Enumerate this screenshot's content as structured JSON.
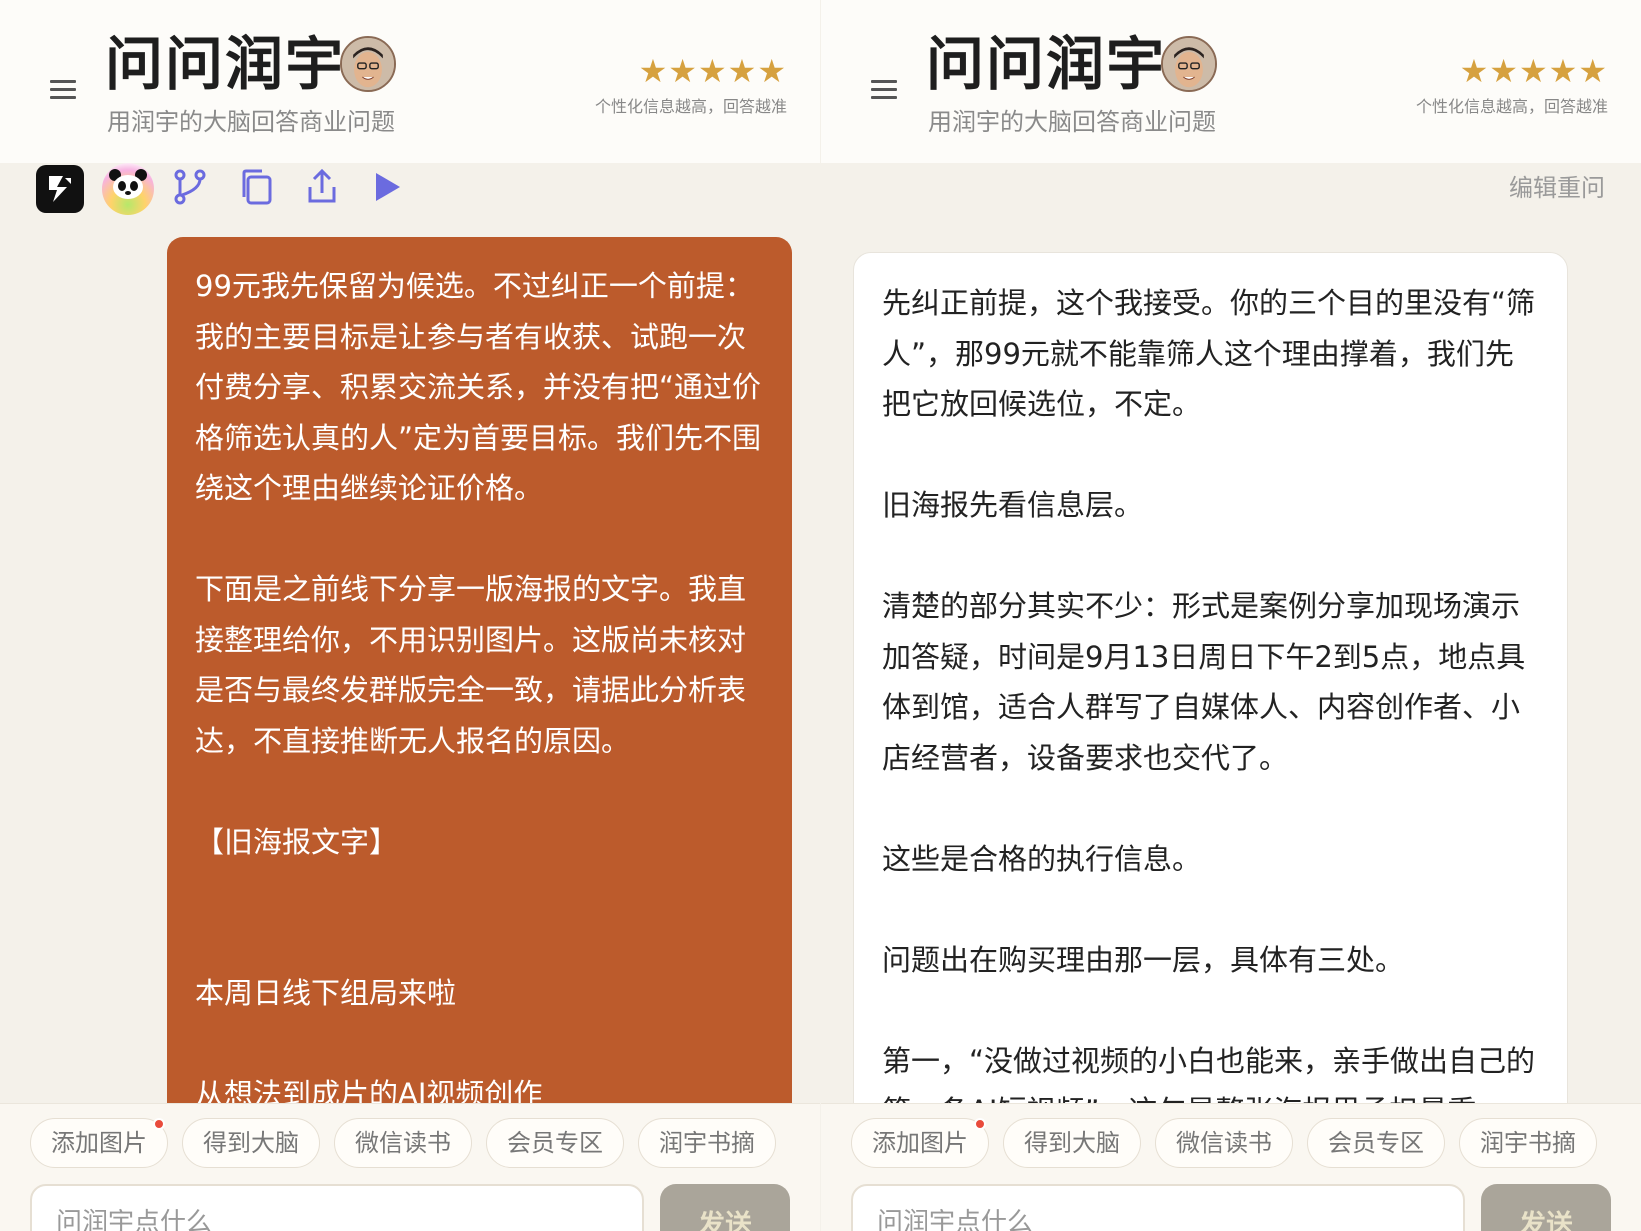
{
  "left": {
    "header": {
      "title": "问问润宇",
      "subtitle": "用润宇的大脑回答商业问题",
      "stars": "★★★★★",
      "rating_note": "个性化信息越高，回答越准"
    },
    "message": {
      "paragraphs": [
        "99元我先保留为候选。不过纠正一个前提：我的主要目标是让参与者有收获、试跑一次付费分享、积累交流关系，并没有把“通过价格筛选认真的人”定为首要目标。我们先不围绕这个理由继续论证价格。",
        "下面是之前线下分享一版海报的文字。我直接整理给你，不用识别图片。这版尚未核对是否与最终发群版完全一致，请据此分析表达，不直接推断无人报名的原因。",
        "【旧海报文字】",
        "本周日线下组局来啦",
        "从想法到成片的AI视频创作"
      ]
    },
    "chips": [
      "添加图片",
      "得到大脑",
      "微信读书",
      "会员专区",
      "润宇书摘"
    ],
    "input": {
      "placeholder": "问润宇点什么"
    },
    "send_label": "发送"
  },
  "right": {
    "header": {
      "title": "问问润宇",
      "subtitle": "用润宇的大脑回答商业问题",
      "stars": "★★★★★",
      "rating_note": "个性化信息越高，回答越准"
    },
    "edit_link": "编辑重问",
    "message": {
      "paragraphs": [
        "先纠正前提，这个我接受。你的三个目的里没有“筛人”，那99元就不能靠筛人这个理由撑着，我们先把它放回候选位，不定。",
        "旧海报先看信息层。",
        "清楚的部分其实不少：形式是案例分享加现场演示加答疑，时间是9月13日周日下午2到5点，地点具体到馆，适合人群写了自媒体人、内容创作者、小店经营者，设备要求也交代了。",
        "这些是合格的执行信息。",
        "问题出在购买理由那一层，具体有三处。",
        "第一，“没做过视频的小白也能来，亲手做出自己的第一条AI短视频”，这句是整张海报里承担最重"
      ]
    },
    "chips": [
      "添加图片",
      "得到大脑",
      "微信读书",
      "会员专区",
      "润宇书摘"
    ],
    "input": {
      "placeholder": "问润宇点什么"
    },
    "send_label": "发送"
  }
}
